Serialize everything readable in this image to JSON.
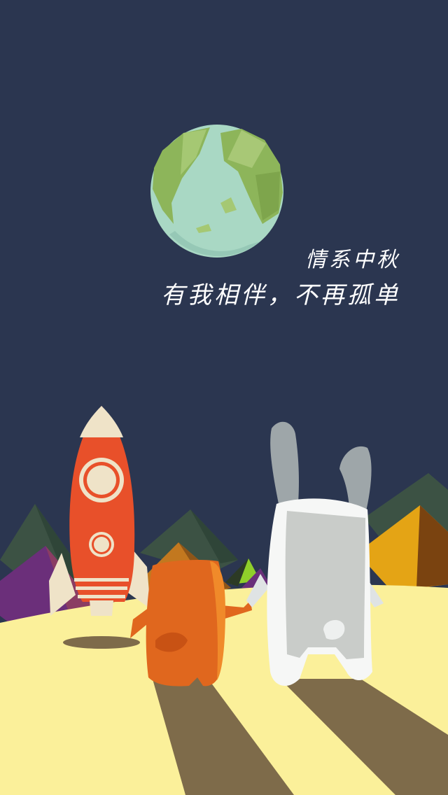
{
  "caption": {
    "line1": "情系中秋",
    "line2": "有我相伴，不再孤单"
  },
  "colors": {
    "sky": "#2b3650",
    "ground": "#fbf09a",
    "rocket_body": "#e8502a",
    "rocket_cream": "#efe3c8",
    "orange_creature": "#e0671e",
    "rabbit": "#c9ccc9",
    "earth_land": "#8db55a",
    "earth_sea": "#a9d8c4"
  }
}
